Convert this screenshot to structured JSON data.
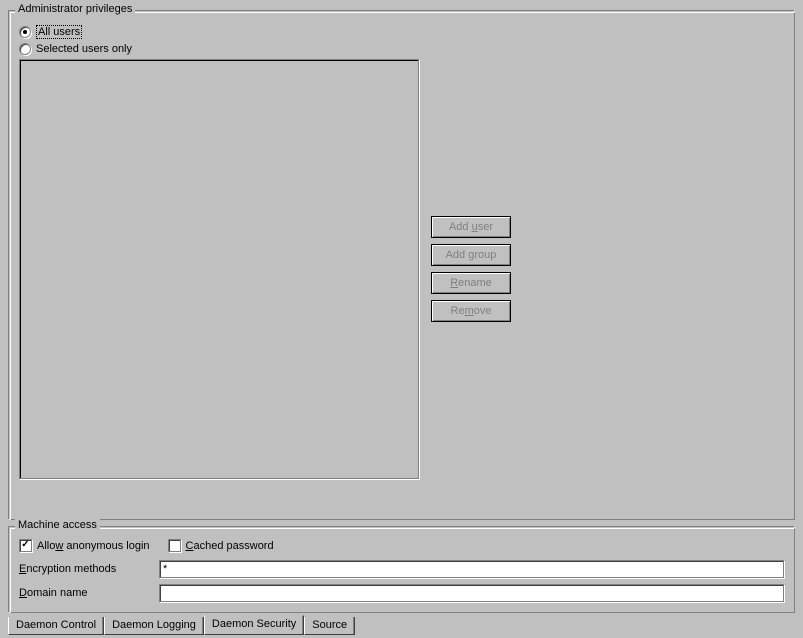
{
  "admin": {
    "legend": "Administrator privileges",
    "radio_all_pre": "",
    "radio_all_u": "A",
    "radio_all_post": "ll users",
    "radio_sel_pre": "",
    "radio_sel_u": "S",
    "radio_sel_post": "elected users only",
    "selected": "all",
    "buttons": {
      "add_user_pre": "Add ",
      "add_user_u": "u",
      "add_user_post": "ser",
      "add_group_pre": "Add ",
      "add_group_u": "g",
      "add_group_post": "roup",
      "rename_pre": "",
      "rename_u": "R",
      "rename_post": "ename",
      "remove_pre": "Re",
      "remove_u": "m",
      "remove_post": "ove"
    }
  },
  "machine": {
    "legend": "Machine access",
    "allow_anon_pre": "Allo",
    "allow_anon_u": "w",
    "allow_anon_post": " anonymous login",
    "allow_anon_checked": true,
    "cached_pre": "",
    "cached_u": "C",
    "cached_post": "ached password",
    "cached_checked": false,
    "enc_label_pre": "",
    "enc_label_u": "E",
    "enc_label_post": "ncryption methods",
    "enc_value": "*",
    "domain_label_pre": "",
    "domain_label_u": "D",
    "domain_label_post": "omain name",
    "domain_value": ""
  },
  "tabs": {
    "items": [
      {
        "label": "Daemon Control"
      },
      {
        "label": "Daemon Logging"
      },
      {
        "label": "Daemon Security"
      },
      {
        "label": "Source"
      }
    ],
    "active": 2
  }
}
